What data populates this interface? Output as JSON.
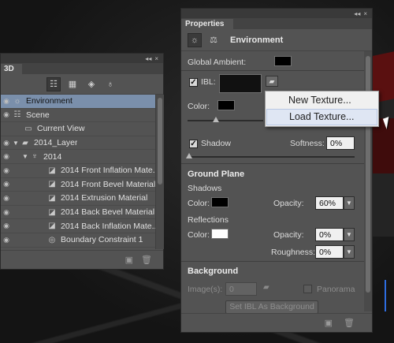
{
  "panel3d": {
    "tab": "3D",
    "window_controls": [
      "◂◂",
      "×"
    ],
    "filters": [
      "scene-filter-icon",
      "mesh-filter-icon",
      "material-filter-icon",
      "light-filter-icon"
    ],
    "tree": [
      {
        "label": "Environment",
        "icon": "environment-icon",
        "indent": 0,
        "selected": true
      },
      {
        "label": "Scene",
        "icon": "scene-icon",
        "indent": 0
      },
      {
        "label": "Current View",
        "icon": "camera-icon",
        "indent": 1
      },
      {
        "label": "2014_Layer",
        "icon": "mesh-folder-icon",
        "indent": 0,
        "expand": true
      },
      {
        "label": "2014",
        "icon": "mesh-icon",
        "indent": 1,
        "expand": true
      },
      {
        "label": "2014 Front Inflation Mate...",
        "icon": "material-icon",
        "indent": 2
      },
      {
        "label": "2014 Front Bevel Material",
        "icon": "material-icon",
        "indent": 2
      },
      {
        "label": "2014 Extrusion Material",
        "icon": "material-icon",
        "indent": 2
      },
      {
        "label": "2014 Back Bevel Material",
        "icon": "material-icon",
        "indent": 2
      },
      {
        "label": "2014 Back Inflation Mate...",
        "icon": "material-icon",
        "indent": 2
      },
      {
        "label": "Boundary Constraint 1",
        "icon": "constraint-icon",
        "indent": 2
      }
    ]
  },
  "properties": {
    "tab": "Properties",
    "window_controls": [
      "◂◂",
      "×"
    ],
    "header_title": "Environment",
    "global_ambient_label": "Global Ambient:",
    "ibl_label": "IBL:",
    "ibl_checked": true,
    "color_label": "Color:",
    "shadow_label": "Shadow",
    "shadow_checked": true,
    "softness_label": "Softness:",
    "softness_value": "0%",
    "ground_plane_label": "Ground Plane",
    "shadows_label": "Shadows",
    "shadows_color_label": "Color:",
    "shadows_opacity_label": "Opacity:",
    "shadows_opacity_value": "60%",
    "reflections_label": "Reflections",
    "reflections_color_label": "Color:",
    "reflections_opacity_label": "Opacity:",
    "reflections_opacity_value": "0%",
    "roughness_label": "Roughness:",
    "roughness_value": "0%",
    "background_label": "Background",
    "images_label": "Image(s):",
    "images_value": "0",
    "panorama_label": "Panorama",
    "set_ibl_button": "Set IBL As Background"
  },
  "context_menu": {
    "items": [
      "New Texture...",
      "Load Texture..."
    ],
    "hovered_index": 1
  },
  "colors": {
    "panel_bg": "#535353",
    "selection": "#7a8fab",
    "menu_bg": "#f0f0f0"
  }
}
